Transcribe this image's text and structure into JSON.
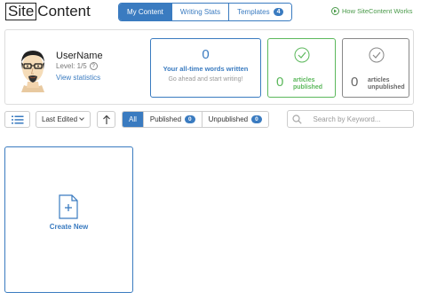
{
  "header": {
    "logo_site": "Site",
    "logo_content": "Content",
    "tabs": [
      {
        "label": "My Content",
        "active": true
      },
      {
        "label": "Writing Stats",
        "active": false
      },
      {
        "label": "Templates",
        "badge": "4",
        "active": false
      }
    ],
    "how_link": "How SiteContent Works"
  },
  "profile": {
    "username": "UserName",
    "level": "Level: 1/5",
    "help_glyph": "?",
    "stats_link": "View statistics"
  },
  "stats": {
    "words_count": "0",
    "words_label": "Your all-time words written",
    "words_sub": "Go ahead and start writing!",
    "published_count": "0",
    "published_label_1": "articles",
    "published_label_2": "published",
    "unpublished_count": "0",
    "unpublished_label_1": "articles",
    "unpublished_label_2": "unpublished"
  },
  "toolbar": {
    "sort_label": "Last Edited",
    "filters": [
      {
        "label": "All",
        "active": true
      },
      {
        "label": "Published",
        "count": "0"
      },
      {
        "label": "Unpublished",
        "count": "0"
      }
    ],
    "search_placeholder": "Search by Keyword..."
  },
  "create": {
    "label": "Create New",
    "plus_glyph": "+"
  },
  "colors": {
    "primary": "#3a7bc0",
    "success": "#5cb85c",
    "muted": "#888888"
  }
}
